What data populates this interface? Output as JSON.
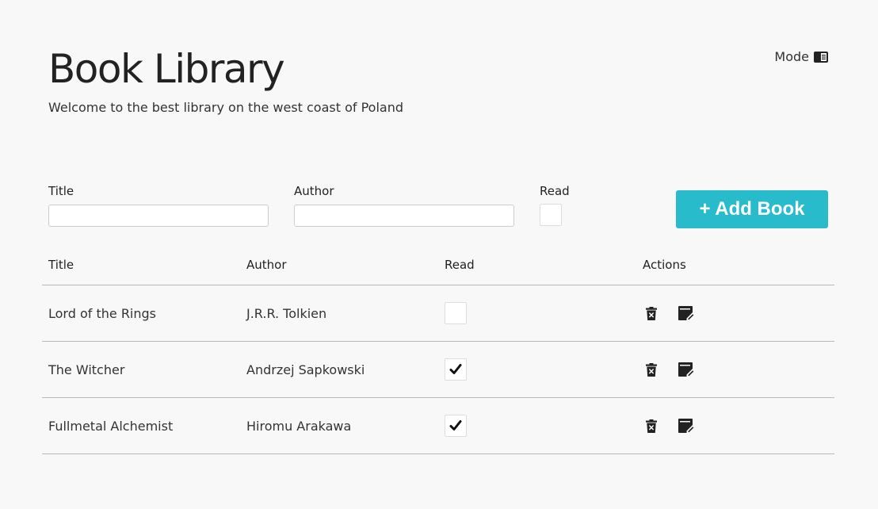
{
  "header": {
    "title": "Book Library",
    "subtitle": "Welcome to the best library on the west coast of Poland",
    "mode_label": "Mode",
    "mode_icon": "book-reader-icon"
  },
  "form": {
    "title_label": "Title",
    "title_value": "",
    "author_label": "Author",
    "author_value": "",
    "read_label": "Read",
    "read_checked": false,
    "add_button_label": "+ Add Book"
  },
  "table": {
    "headers": [
      "Title",
      "Author",
      "Read",
      "Actions"
    ],
    "rows": [
      {
        "title": "Lord of the Rings",
        "author": "J.R.R. Tolkien",
        "read": false
      },
      {
        "title": "The Witcher",
        "author": "Andrzej Sapkowski",
        "read": true
      },
      {
        "title": "Fullmetal Alchemist",
        "author": "Hiromu Arakawa",
        "read": true
      }
    ],
    "delete_icon": "trash-delete-icon",
    "edit_icon": "edit-note-icon"
  },
  "colors": {
    "background": "#f8f8f8",
    "accent": "#27bbcc"
  }
}
